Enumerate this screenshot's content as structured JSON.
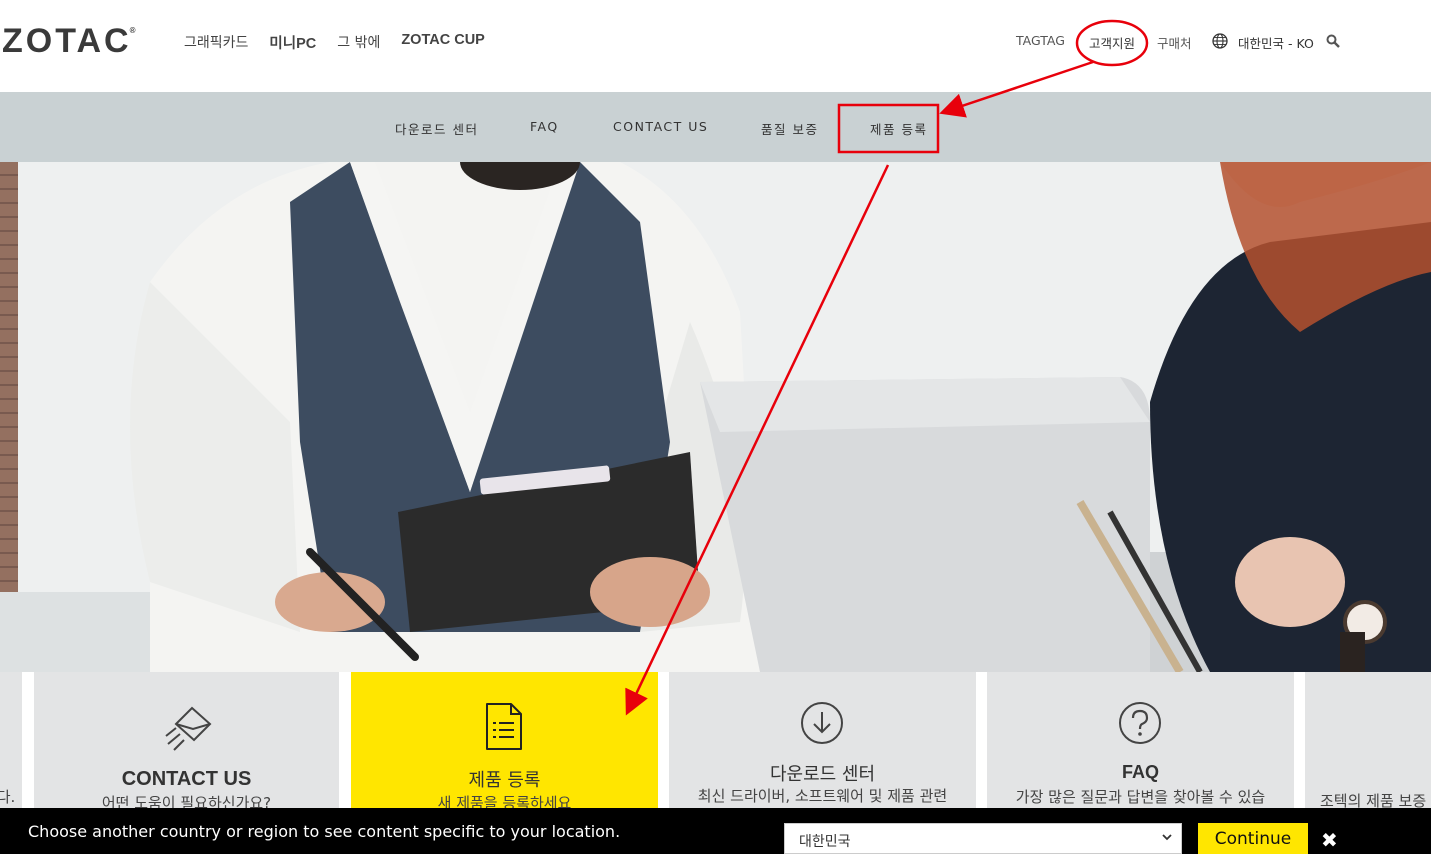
{
  "header": {
    "logo": "ZOTAC",
    "logo_mark": "®",
    "nav": [
      "그래픽카드",
      "미니PC",
      "그 밖에",
      "ZOTAC CUP"
    ],
    "tagtag": "TAGTAG",
    "support": "고객지원",
    "where_to_buy": "구매처",
    "region": "대한민국 - KO"
  },
  "subnav": {
    "items": [
      "다운로드 센터",
      "FAQ",
      "CONTACT US",
      "품질 보증",
      "제품 등록"
    ]
  },
  "tiles": {
    "contact_title": "CONTACT US",
    "contact_sub": "어떤 도움이 필요하신가요?",
    "register_title": "제품 등록",
    "register_sub": "새 제품을 등록하세요",
    "download_title": "다운로드 센터",
    "download_sub": "최신 드라이버, 소프트웨어 및 제품 관련",
    "faq_title": "FAQ",
    "faq_sub": "가장 많은 질문과 답변을 찾아볼 수 있습",
    "warranty_sub": "조텍의 제품 보증",
    "left_partial": "다."
  },
  "cookie_bar": {
    "message": "Choose another country or region to see content specific to your location.",
    "selected_region": "대한민국",
    "continue_label": "Continue",
    "close_glyph": "✖"
  },
  "colors": {
    "accent_yellow": "#ffe600",
    "subnav_bg": "#c9d1d3",
    "annotation_red": "#e8000b"
  }
}
